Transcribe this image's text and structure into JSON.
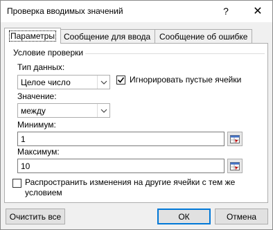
{
  "dialog": {
    "title": "Проверка вводимых значений",
    "help_glyph": "?",
    "close_glyph": "✕"
  },
  "tabs": [
    {
      "label": "Параметры",
      "active": true
    },
    {
      "label": "Сообщение для ввода",
      "active": false
    },
    {
      "label": "Сообщение об ошибке",
      "active": false
    }
  ],
  "criteria": {
    "group_title": "Условие проверки",
    "data_type_label": "Тип данных:",
    "data_type_value": "Целое число",
    "ignore_blank_label": "Игнорировать пустые ячейки",
    "ignore_blank_checked": true,
    "operator_label": "Значение:",
    "operator_value": "между",
    "min_label": "Минимум:",
    "min_value": "1",
    "max_label": "Максимум:",
    "max_value": "10"
  },
  "apply_all": {
    "line1": "Распространить изменения на другие ячейки с тем же",
    "line2": "условием",
    "checked": false
  },
  "buttons": {
    "clear_all": "Очистить все",
    "ok": "ОК",
    "cancel": "Отмена"
  },
  "icons": {
    "dropdown": "chevron-down-icon",
    "checkmark": "checkmark-icon",
    "collapse_dialog": "collapse-dialog-icon"
  },
  "colors": {
    "dialog_background": "#f0f0f0",
    "default_button_border": "#0078d7"
  }
}
